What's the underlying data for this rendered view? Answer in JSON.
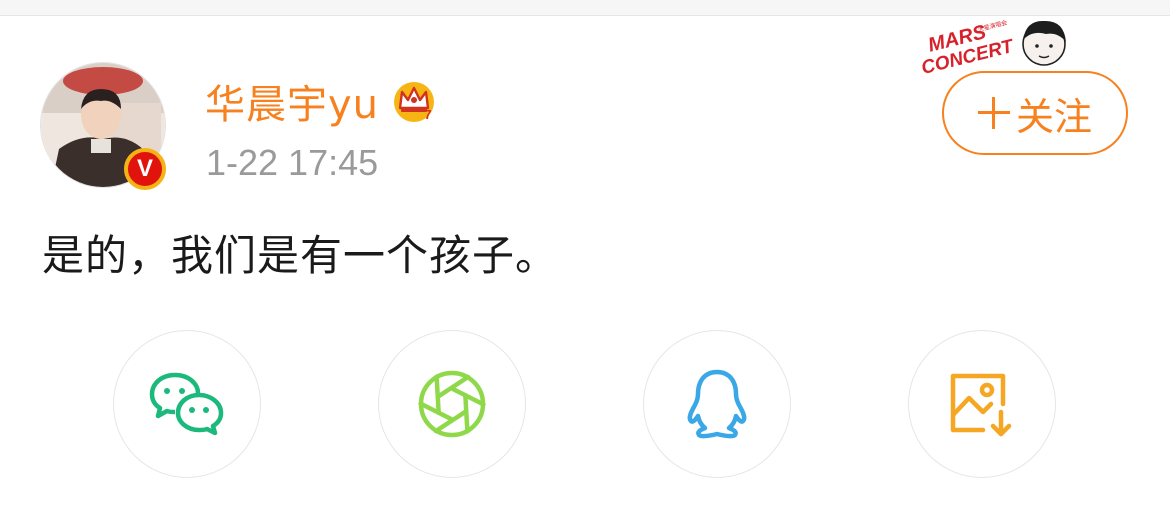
{
  "post": {
    "username": "华晨宇yu",
    "timestamp": "1-22 17:45",
    "text": "是的，我们是有一个孩子。",
    "verified_badge": "V",
    "crown_badge_level": "7"
  },
  "follow": {
    "label": "关注"
  },
  "banner": {
    "line1": "MARS",
    "line2": "CONCERT",
    "small": "火星演唱会"
  },
  "share_targets": [
    {
      "icon": "wechat-icon",
      "color": "#1bb97c"
    },
    {
      "icon": "wechat-moments-icon",
      "color": "#8fd84a"
    },
    {
      "icon": "qq-icon",
      "color": "#3aa7e6"
    },
    {
      "icon": "save-image-icon",
      "color": "#f5a623"
    }
  ],
  "colors": {
    "accent": "#f7811f",
    "timestamp": "#9a9a9a",
    "verified": "#e0140c"
  }
}
